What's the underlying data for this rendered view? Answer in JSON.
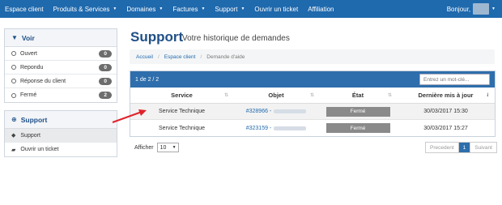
{
  "nav": {
    "items": [
      {
        "label": "Espace client",
        "caret": false
      },
      {
        "label": "Produits & Services",
        "caret": true
      },
      {
        "label": "Domaines",
        "caret": true
      },
      {
        "label": "Factures",
        "caret": true
      },
      {
        "label": "Support",
        "caret": true
      },
      {
        "label": "Ouvrir un ticket",
        "caret": false
      },
      {
        "label": "Affiliation",
        "caret": false
      }
    ],
    "greeting": "Bonjour,"
  },
  "sidebar": {
    "view_title": "Voir",
    "filters": [
      {
        "label": "Ouvert",
        "count": "0"
      },
      {
        "label": "Repondu",
        "count": "0"
      },
      {
        "label": "Réponse du client",
        "count": "0"
      },
      {
        "label": "Fermé",
        "count": "2"
      }
    ],
    "support_title": "Support",
    "support_links": [
      {
        "label": "Support",
        "icon": "ticket-icon"
      },
      {
        "label": "Ouvrir un ticket",
        "icon": "comments-icon"
      }
    ]
  },
  "page": {
    "title": "Support",
    "subtitle": "Votre historique de demandes"
  },
  "breadcrumb": {
    "home": "Accueil",
    "client": "Espace client",
    "current": "Demande d'aide"
  },
  "table": {
    "info": "1 de 2 / 2",
    "search_placeholder": "Entrez un mot-clé...",
    "headers": [
      "Service",
      "Objet",
      "État",
      "Dernière mis à jour"
    ],
    "rows": [
      {
        "service": "Service Technique",
        "ticket": "#328966 -",
        "status": "Fermé",
        "updated": "30/03/2017 15:30"
      },
      {
        "service": "Service Technique",
        "ticket": "#323159 -",
        "status": "Fermé",
        "updated": "30/03/2017 15:27"
      }
    ],
    "show_label": "Afficher",
    "page_size": "10",
    "pager": {
      "prev": "Precedent",
      "current": "1",
      "next": "Suivant"
    }
  },
  "colors": {
    "nav": "#1f69ad",
    "accent": "#1f4f87",
    "status": "#8a8a8a",
    "arrow": "#e0232b"
  }
}
